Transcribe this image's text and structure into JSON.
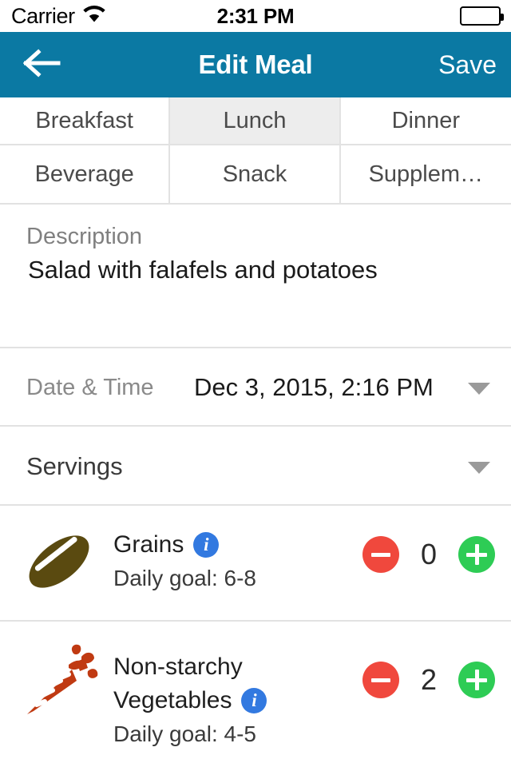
{
  "status_bar": {
    "carrier": "Carrier",
    "wifi_icon": "wifi-icon",
    "time": "2:31 PM",
    "battery_icon": "battery-full-icon"
  },
  "nav_bar": {
    "back_icon": "arrow-left-icon",
    "title": "Edit Meal",
    "save_label": "Save",
    "background_color": "#0b79a3"
  },
  "meal_types": {
    "options": [
      {
        "label": "Breakfast",
        "selected": false
      },
      {
        "label": "Lunch",
        "selected": true
      },
      {
        "label": "Dinner",
        "selected": false
      },
      {
        "label": "Beverage",
        "selected": false
      },
      {
        "label": "Snack",
        "selected": false
      },
      {
        "label": "Supplem…",
        "selected": false
      }
    ],
    "selected_color": "#ededed"
  },
  "description": {
    "label": "Description",
    "value": "Salad with falafels and potatoes"
  },
  "date_time": {
    "label": "Date & Time",
    "value": "Dec 3, 2015, 2:16 PM",
    "caret_icon": "chevron-down-icon"
  },
  "servings": {
    "label": "Servings",
    "caret_icon": "chevron-down-icon"
  },
  "food_groups": [
    {
      "icon": "bread-loaf-icon",
      "icon_color": "#5a4a10",
      "name": "Grains",
      "name_line_2": "",
      "info_icon": "info-icon",
      "info_on_line": 1,
      "goal_label": "Daily goal: 6-8",
      "count": "0",
      "minus_icon": "minus-circle-icon",
      "plus_icon": "plus-circle-icon"
    },
    {
      "icon": "carrot-icon",
      "icon_color": "#c03a12",
      "name": "Non-starchy",
      "name_line_2": "Vegetables",
      "info_icon": "info-icon",
      "info_on_line": 2,
      "goal_label": "Daily goal: 4-5",
      "count": "2",
      "minus_icon": "minus-circle-icon",
      "plus_icon": "plus-circle-icon"
    }
  ],
  "colors": {
    "accent": "#0b79a3",
    "minus": "#f0483d",
    "plus": "#2ecc55",
    "info": "#3279e0",
    "divider": "#e2e2e2"
  }
}
